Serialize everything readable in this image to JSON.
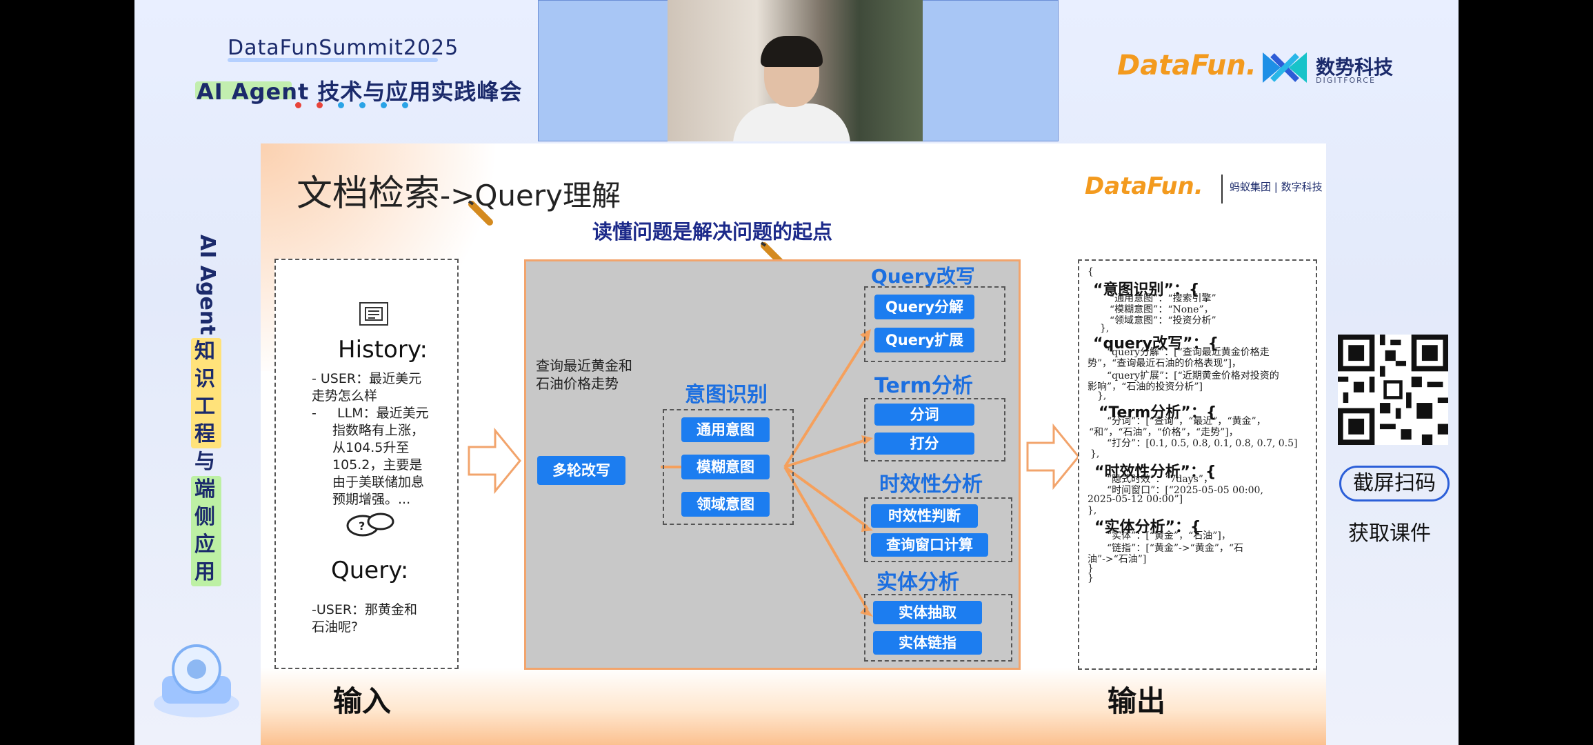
{
  "header": {
    "summit": "DataFunSummit2025",
    "forum": "AI Agent 技术与应用实践峰会",
    "logo_datafun": "DataFun.",
    "logo_digitforce": "数势科技",
    "logo_digitforce_sub": "DIGITFORCE",
    "dot_colors": [
      "#e8443a",
      "#e8443a",
      "#2aa3e6",
      "#2aa3e6",
      "#2aa3e6",
      "#2aa3e6"
    ]
  },
  "side_title": {
    "latin": "AI Agent",
    "part1": [
      "知",
      "识",
      "工",
      "程"
    ],
    "conj": "与",
    "part2": [
      "端",
      "侧",
      "应",
      "用"
    ]
  },
  "qr": {
    "caption": "截屏扫码",
    "sub": "获取课件"
  },
  "slide": {
    "title": "文档检索",
    "title_suffix": "->Query理解",
    "logo_datafun": "DataFun.",
    "logo_ant": "蚂蚁集团 | 数字科技",
    "subtitle": "读懂问题是解决问题的起点",
    "input": {
      "history_title": "History:",
      "lines": [
        "- USER：最近美元",
        "走势怎么样",
        "-     LLM：最近美元",
        "指数略有上涨，",
        "从104.5升至",
        "105.2，主要是",
        "由于美联储加息",
        "预期增强。..."
      ],
      "query_title": "Query:",
      "query_lines": [
        "-USER：那黄金和",
        "石油呢?"
      ]
    },
    "middle": {
      "query_text": [
        "查询最近黄金和",
        "石油价格走势"
      ],
      "multi_rewrite": "多轮改写",
      "intent_title": "意图识别",
      "intent_items": [
        "通用意图",
        "模糊意图",
        "领域意图"
      ],
      "sections": [
        {
          "title": "Query改写",
          "items": [
            "Query分解",
            "Query扩展"
          ]
        },
        {
          "title": "Term分析",
          "items": [
            "分词",
            "打分"
          ]
        },
        {
          "title": "时效性分析",
          "items": [
            "时效性判断",
            "查询窗口计算"
          ]
        },
        {
          "title": "实体分析",
          "items": [
            "实体抽取",
            "实体链指"
          ]
        }
      ]
    },
    "output": {
      "lines": [
        {
          "text": "{",
          "h": false
        },
        {
          "text": "“意图识别”：{",
          "h": true
        },
        {
          "text": "“通用意图”：“搜索引擎”",
          "h": false
        },
        {
          "text": "“模糊意图”：“None”，",
          "h": false
        },
        {
          "text": "“领域意图”：“投资分析”",
          "h": false
        },
        {
          "text": "},",
          "h": false
        },
        {
          "text": "“query改写”：{",
          "h": true
        },
        {
          "text": "“query分解”：[“查询最近黄金价格走",
          "h": false
        },
        {
          "text": "势”，“查询最近石油的价格表现”]，",
          "h": false
        },
        {
          "text": "“query扩展”：[“近期黄金价格对投资的",
          "h": false
        },
        {
          "text": "影响”，“石油的投资分析”]",
          "h": false
        },
        {
          "text": "},",
          "h": false
        },
        {
          "text": "“Term分析”：{",
          "h": true
        },
        {
          "text": "“分词”：[“查询”，“最近”，“黄金”，",
          "h": false
        },
        {
          "text": "“和”，“石油”，“价格”，“走势”]，",
          "h": false
        },
        {
          "text": "“打分”：[0.1, 0.5, 0.8, 0.1, 0.8, 0.7, 0.5]",
          "h": false
        },
        {
          "text": "},",
          "h": false
        },
        {
          "text": "“时效性分析”：{",
          "h": true
        },
        {
          "text": "“隐式时效”：“7days”，",
          "h": false
        },
        {
          "text": "“时间窗口”：[“2025-05-05 00:00,",
          "h": false
        },
        {
          "text": "2025-05-12 00:00”]",
          "h": false
        },
        {
          "text": "},",
          "h": false
        },
        {
          "text": "“实体分析”：{",
          "h": true
        },
        {
          "text": "“实体”：[“黄金”，“石油”]，",
          "h": false
        },
        {
          "text": "“链指”：[“黄金”->“黄金”，“石",
          "h": false
        },
        {
          "text": "油”->“石油”]",
          "h": false
        },
        {
          "text": "}",
          "h": false
        },
        {
          "text": "}",
          "h": false
        }
      ]
    },
    "footer": {
      "input": "输入",
      "output": "输出"
    }
  }
}
